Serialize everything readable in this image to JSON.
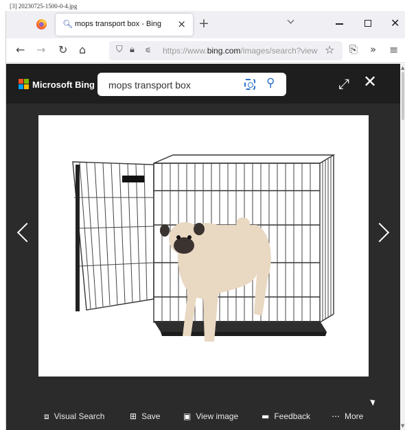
{
  "file_label": "[3] 20230725-1500-0-4.jpg",
  "browser": {
    "tab": {
      "title": "mops transport box - Bing",
      "icon": "search-icon"
    },
    "url": {
      "prefix": "https://www.",
      "domain": "bing.com",
      "rest": "/images/search?view"
    }
  },
  "bing": {
    "brand": "Microsoft Bing",
    "search_query": "mops transport box"
  },
  "actions": [
    {
      "label": "Visual Search",
      "icon": "visual-search-icon"
    },
    {
      "label": "Save",
      "icon": "save-icon"
    },
    {
      "label": "View image",
      "icon": "image-icon"
    },
    {
      "label": "Feedback",
      "icon": "feedback-icon"
    },
    {
      "label": "More",
      "icon": "more-icon"
    }
  ],
  "colors": {
    "viewer_bg": "#2b2b2b",
    "bing_header": "#1e1e1e",
    "accent": "#2a70c8"
  }
}
